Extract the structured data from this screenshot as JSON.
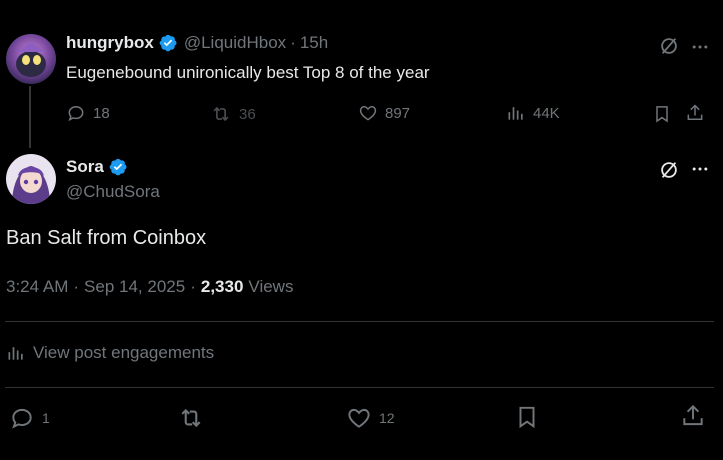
{
  "reply_to": {
    "display_name": "hungrybox",
    "handle": "@LiquidHbox",
    "separator": "·",
    "time_ago": "15h",
    "text": "Eugenebound unironically best Top 8 of the year",
    "stats": {
      "replies": "18",
      "reposts": "36",
      "likes": "897",
      "views": "44K"
    }
  },
  "main_post": {
    "display_name": "Sora",
    "handle": "@ChudSora",
    "text": "Ban Salt from Coinbox",
    "time": "3:24 AM",
    "sep1": "·",
    "date": "Sep 14, 2025",
    "sep2": "·",
    "views_count": "2,330",
    "views_label": "Views",
    "engagements_link": "View post engagements",
    "actions": {
      "replies": "1",
      "reposts": "",
      "likes": "12"
    }
  },
  "colors": {
    "background": "#000000",
    "text_primary": "#e7e9ea",
    "text_secondary": "#71767b",
    "verified_blue": "#1d9bf0",
    "divider": "#2f3336"
  },
  "icons": [
    "verified-badge-icon",
    "grok-icon",
    "more-icon",
    "reply-icon",
    "repost-icon",
    "like-icon",
    "views-icon",
    "bookmark-icon",
    "share-icon"
  ]
}
